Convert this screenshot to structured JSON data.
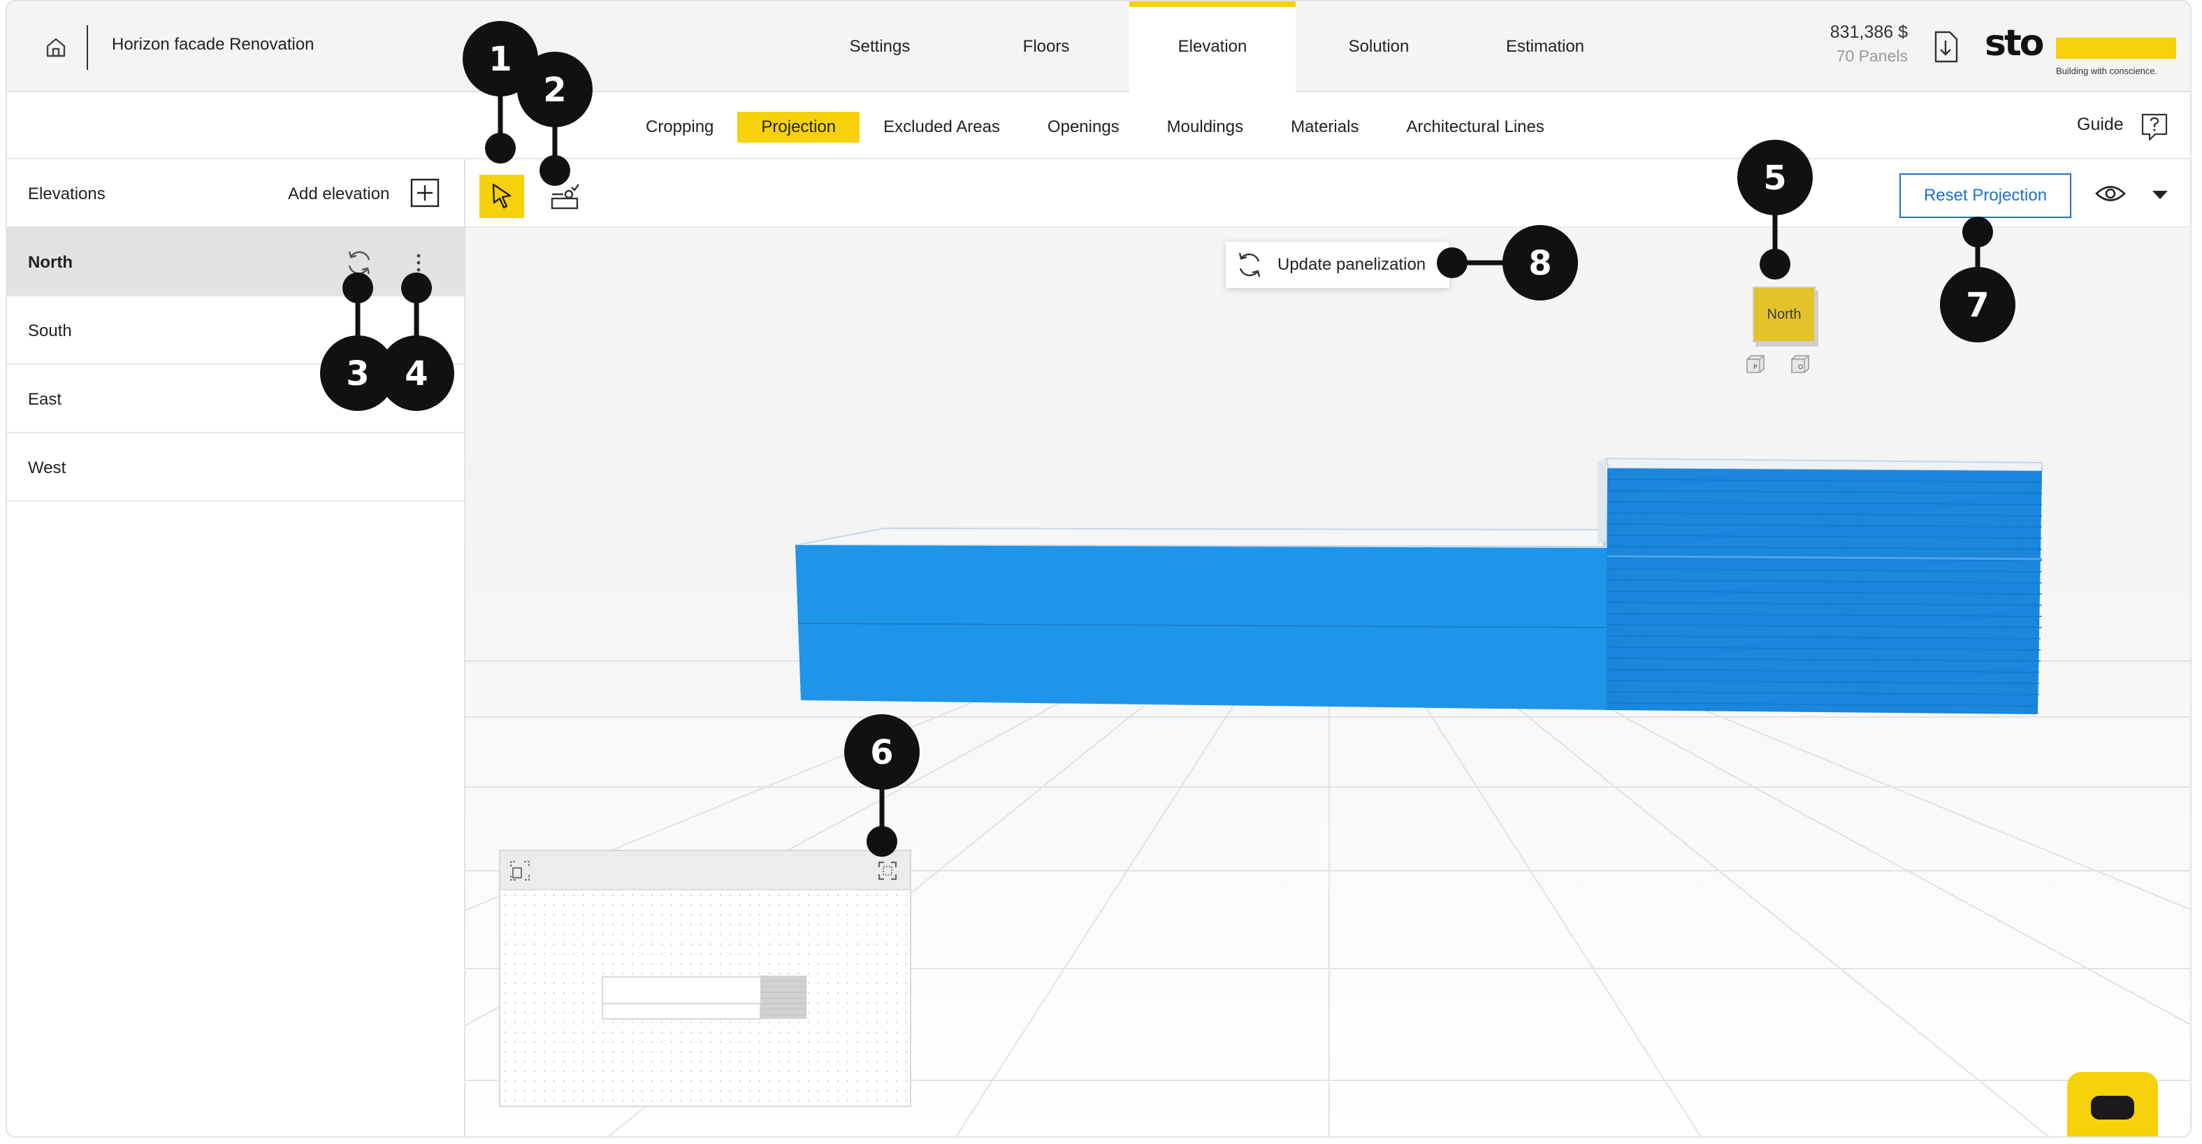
{
  "header": {
    "project_title": "Horizon facade Renovation",
    "tabs": [
      {
        "label": "Settings",
        "active": false
      },
      {
        "label": "Floors",
        "active": false
      },
      {
        "label": "Elevation",
        "active": true
      },
      {
        "label": "Solution",
        "active": false
      },
      {
        "label": "Estimation",
        "active": false
      }
    ],
    "price": "831,386 $",
    "panels": "70 Panels",
    "logo": {
      "word": "sto",
      "tagline": "Building with conscience."
    }
  },
  "subtabs": {
    "items": [
      {
        "label": "Cropping",
        "active": false
      },
      {
        "label": "Projection",
        "active": true
      },
      {
        "label": "Excluded Areas",
        "active": false
      },
      {
        "label": "Openings",
        "active": false
      },
      {
        "label": "Mouldings",
        "active": false
      },
      {
        "label": "Materials",
        "active": false
      },
      {
        "label": "Architectural Lines",
        "active": false
      }
    ],
    "guide_label": "Guide"
  },
  "sidebar": {
    "title": "Elevations",
    "add_label": "Add elevation",
    "items": [
      {
        "name": "North",
        "active": true
      },
      {
        "name": "South",
        "active": false
      },
      {
        "name": "East",
        "active": false
      },
      {
        "name": "West",
        "active": false
      }
    ]
  },
  "toolbar": {
    "reset_label": "Reset Projection"
  },
  "viewport": {
    "update_label": "Update panelization",
    "cube_label": "North",
    "cube_mini_a": "P",
    "cube_mini_b": "O"
  },
  "callouts": [
    "1",
    "2",
    "3",
    "4",
    "5",
    "6",
    "7",
    "8"
  ],
  "colors": {
    "accent": "#f7d10a",
    "building": "#1f95ea",
    "link": "#1f6fd1",
    "callout": "#111111"
  },
  "icons": {
    "home": "home-icon",
    "download": "download-icon",
    "guide": "help-icon",
    "add": "plus-icon",
    "refresh": "refresh-icon",
    "more": "more-vertical-icon",
    "select": "cursor-arrow-icon",
    "project": "projection-tool-icon",
    "eye": "eye-icon",
    "caret": "caret-down-icon",
    "fit": "fit-view-icon",
    "expand": "expand-icon",
    "chat": "chat-icon"
  }
}
